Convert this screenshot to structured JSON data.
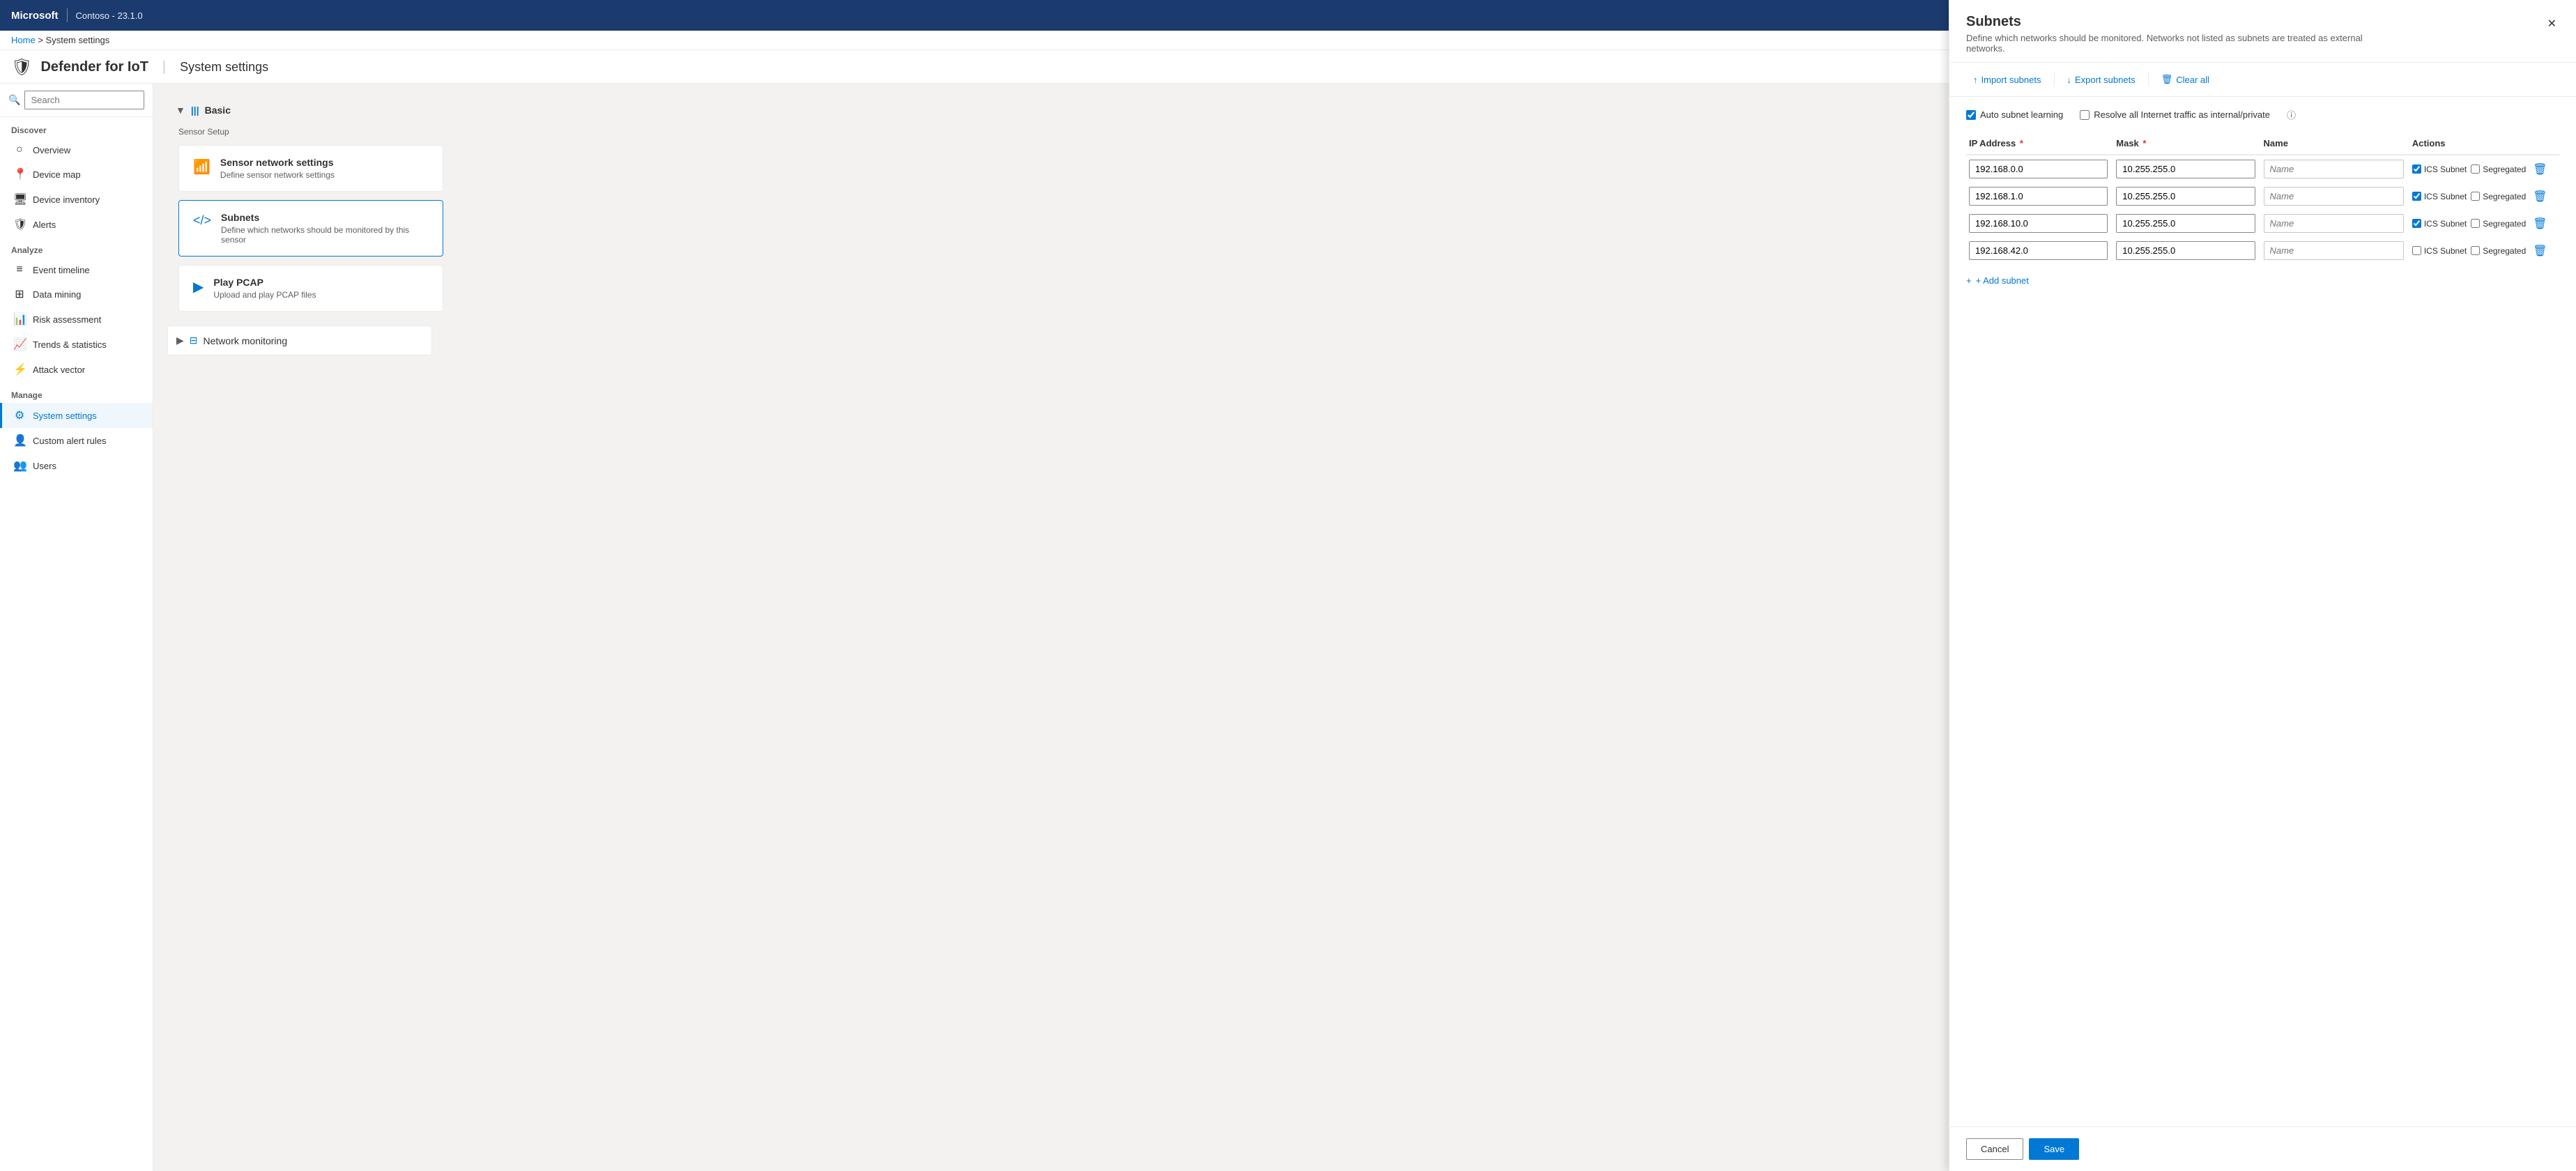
{
  "topbar": {
    "brand": "Microsoft",
    "divider": "|",
    "instance": "Contoso - 23.1.0"
  },
  "breadcrumb": {
    "home": "Home",
    "separator": ">",
    "current": "System settings"
  },
  "page_header": {
    "icon": "🛡",
    "title": "Defender for IoT",
    "separator": "|",
    "subtitle": "System settings"
  },
  "sidebar": {
    "search_placeholder": "Search",
    "sections": [
      {
        "label": "Discover",
        "items": [
          {
            "id": "overview",
            "icon": "○",
            "label": "Overview"
          },
          {
            "id": "device-map",
            "icon": "📍",
            "label": "Device map"
          },
          {
            "id": "device-inventory",
            "icon": "🖥",
            "label": "Device inventory"
          },
          {
            "id": "alerts",
            "icon": "🛡",
            "label": "Alerts"
          }
        ]
      },
      {
        "label": "Analyze",
        "items": [
          {
            "id": "event-timeline",
            "icon": "≡",
            "label": "Event timeline"
          },
          {
            "id": "data-mining",
            "icon": "⊞",
            "label": "Data mining"
          },
          {
            "id": "risk-assessment",
            "icon": "📊",
            "label": "Risk assessment"
          },
          {
            "id": "trends-statistics",
            "icon": "📈",
            "label": "Trends & statistics"
          },
          {
            "id": "attack-vector",
            "icon": "⚡",
            "label": "Attack vector"
          }
        ]
      },
      {
        "label": "Manage",
        "items": [
          {
            "id": "system-settings",
            "icon": "⚙",
            "label": "System settings",
            "active": true
          },
          {
            "id": "custom-alert-rules",
            "icon": "👤",
            "label": "Custom alert rules"
          },
          {
            "id": "users",
            "icon": "👥",
            "label": "Users"
          }
        ]
      }
    ]
  },
  "settings": {
    "basic_section": {
      "label": "Basic",
      "sensor_setup_label": "Sensor Setup",
      "cards": [
        {
          "id": "sensor-network",
          "icon": "📶",
          "title": "Sensor network settings",
          "desc": "Define sensor network settings"
        },
        {
          "id": "subnets",
          "icon": "<>",
          "title": "Subnets",
          "desc": "Define which networks should be monitored by this sensor"
        },
        {
          "id": "play-pcap",
          "icon": "▶",
          "title": "Play PCAP",
          "desc": "Upload and play PCAP files"
        }
      ]
    },
    "network_monitoring": {
      "label": "Network monitoring"
    }
  },
  "panel": {
    "title": "Subnets",
    "subtitle": "Define which networks should be monitored. Networks not listed as subnets are treated as external networks.",
    "toolbar": {
      "import_label": "Import subnets",
      "export_label": "Export subnets",
      "clear_all_label": "Clear all"
    },
    "auto_subnet_label": "Auto subnet learning",
    "resolve_label": "Resolve all Internet traffic as internal/private",
    "table": {
      "columns": [
        "IP Address",
        "Mask",
        "Name",
        "Actions"
      ],
      "rows": [
        {
          "ip": "192.168.0.0",
          "mask": "10.255.255.0",
          "name": "",
          "ics_checked": true,
          "segregated_checked": false
        },
        {
          "ip": "192.168.1.0",
          "mask": "10.255.255.0",
          "name": "",
          "ics_checked": true,
          "segregated_checked": false
        },
        {
          "ip": "192.168.10.0",
          "mask": "10.255.255.0",
          "name": "",
          "ics_checked": true,
          "segregated_checked": false
        },
        {
          "ip": "192.168.42.0",
          "mask": "10.255.255.0",
          "name": "",
          "ics_checked": false,
          "segregated_checked": false
        }
      ],
      "name_placeholder": "Name",
      "ics_label": "ICS Subnet",
      "segregated_label": "Segregated"
    },
    "add_subnet_label": "+ Add subnet",
    "footer": {
      "cancel_label": "Cancel",
      "save_label": "Save"
    }
  }
}
